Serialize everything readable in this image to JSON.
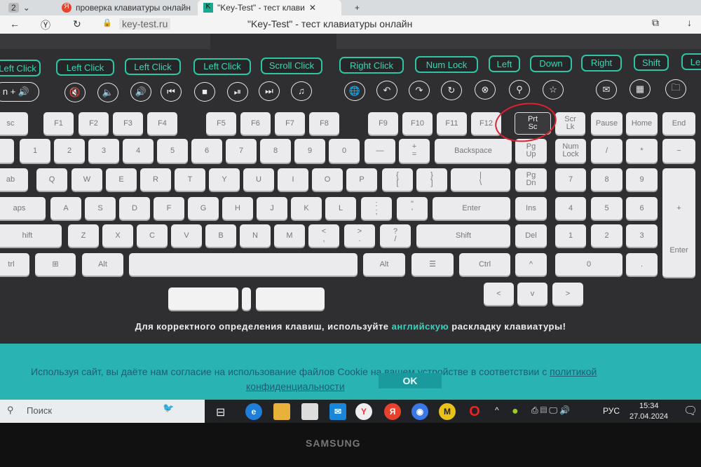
{
  "browser": {
    "tab_count": "2",
    "tabs": [
      {
        "label": "проверка клавиатуры онлайн",
        "icon": "yandex-icon"
      },
      {
        "label": "\"Key-Test\" - тест клави",
        "icon": "k-icon"
      }
    ],
    "url": "key-test.ru",
    "page_title": "\"Key-Test\" - тест клавиатуры онлайн"
  },
  "mouse_buttons": [
    "Left Click",
    "Left Click",
    "Left Click",
    "Left Click",
    "Scroll Click",
    "Right Click",
    "Num Lock",
    "Left",
    "Down",
    "Right",
    "Shift",
    "Le"
  ],
  "media_keys": {
    "first": "n + 🔊",
    "icons": [
      "mute-icon",
      "volume-down-icon",
      "volume-up-icon",
      "previous-icon",
      "stop-icon",
      "play-pause-icon",
      "next-icon",
      "music-icon",
      "globe-icon",
      "back-icon",
      "forward-icon",
      "refresh-icon",
      "close-circle-icon",
      "search-icon",
      "star-icon",
      "mail-icon",
      "calculator-icon",
      "folder-icon"
    ]
  },
  "keyboard": {
    "rows": [
      [
        "sc",
        "F1",
        "F2",
        "F3",
        "F4",
        "F5",
        "F6",
        "F7",
        "F8",
        "F9",
        "F10",
        "F11",
        "F12",
        "Prt\nSc",
        "Scr\nLk",
        "Pause",
        "Home",
        "End"
      ],
      [
        "",
        "1",
        "2",
        "3",
        "4",
        "5",
        "6",
        "7",
        "8",
        "9",
        "0",
        "—",
        "+\n=",
        "Backspace",
        "Pg\nUp",
        "Num\nLock",
        "/",
        "*",
        "−"
      ],
      [
        "ab",
        "Q",
        "W",
        "E",
        "R",
        "T",
        "Y",
        "U",
        "I",
        "O",
        "P",
        "{\n[",
        "}\n]",
        "|\n\\",
        "Pg\nDn",
        "7",
        "8",
        "9",
        "+"
      ],
      [
        "aps",
        "A",
        "S",
        "D",
        "F",
        "G",
        "H",
        "J",
        "K",
        "L",
        ":\n;",
        "\"\n'",
        "Enter",
        "Ins",
        "4",
        "5",
        "6"
      ],
      [
        "hift",
        "Z",
        "X",
        "C",
        "V",
        "B",
        "N",
        "M",
        "<\n,",
        ">\n.",
        "?\n/",
        "Shift",
        "Del",
        "1",
        "2",
        "3",
        "Enter"
      ],
      [
        "trl",
        "⊞",
        "Alt",
        "",
        "Alt",
        "☰",
        "Ctrl",
        "^",
        "0",
        "."
      ],
      [
        "<",
        "v",
        ">"
      ],
      [
        "",
        "",
        ""
      ]
    ],
    "pressed": "Prt\nSc"
  },
  "notice": {
    "before": "Для корректного определения клавиш, используйте ",
    "link": "английскую",
    "after": " раскладку клавиатуры!"
  },
  "cookie": {
    "text": "Используя сайт, вы даёте нам согласие на использование файлов Cookie на вашем устройстве в соответствии с ",
    "link1": "политикой",
    "link2": "конфиденциальности",
    "ok": "OK"
  },
  "taskbar": {
    "search_placeholder": "Поиск",
    "lang": "РУС",
    "time": "15:34",
    "date": "27.04.2024"
  },
  "monitor": {
    "brand": "SAMSUNG"
  },
  "colors": {
    "accent": "#2fc5a4",
    "cookie_bg": "#2ab3b3",
    "annotation": "#e02030"
  }
}
